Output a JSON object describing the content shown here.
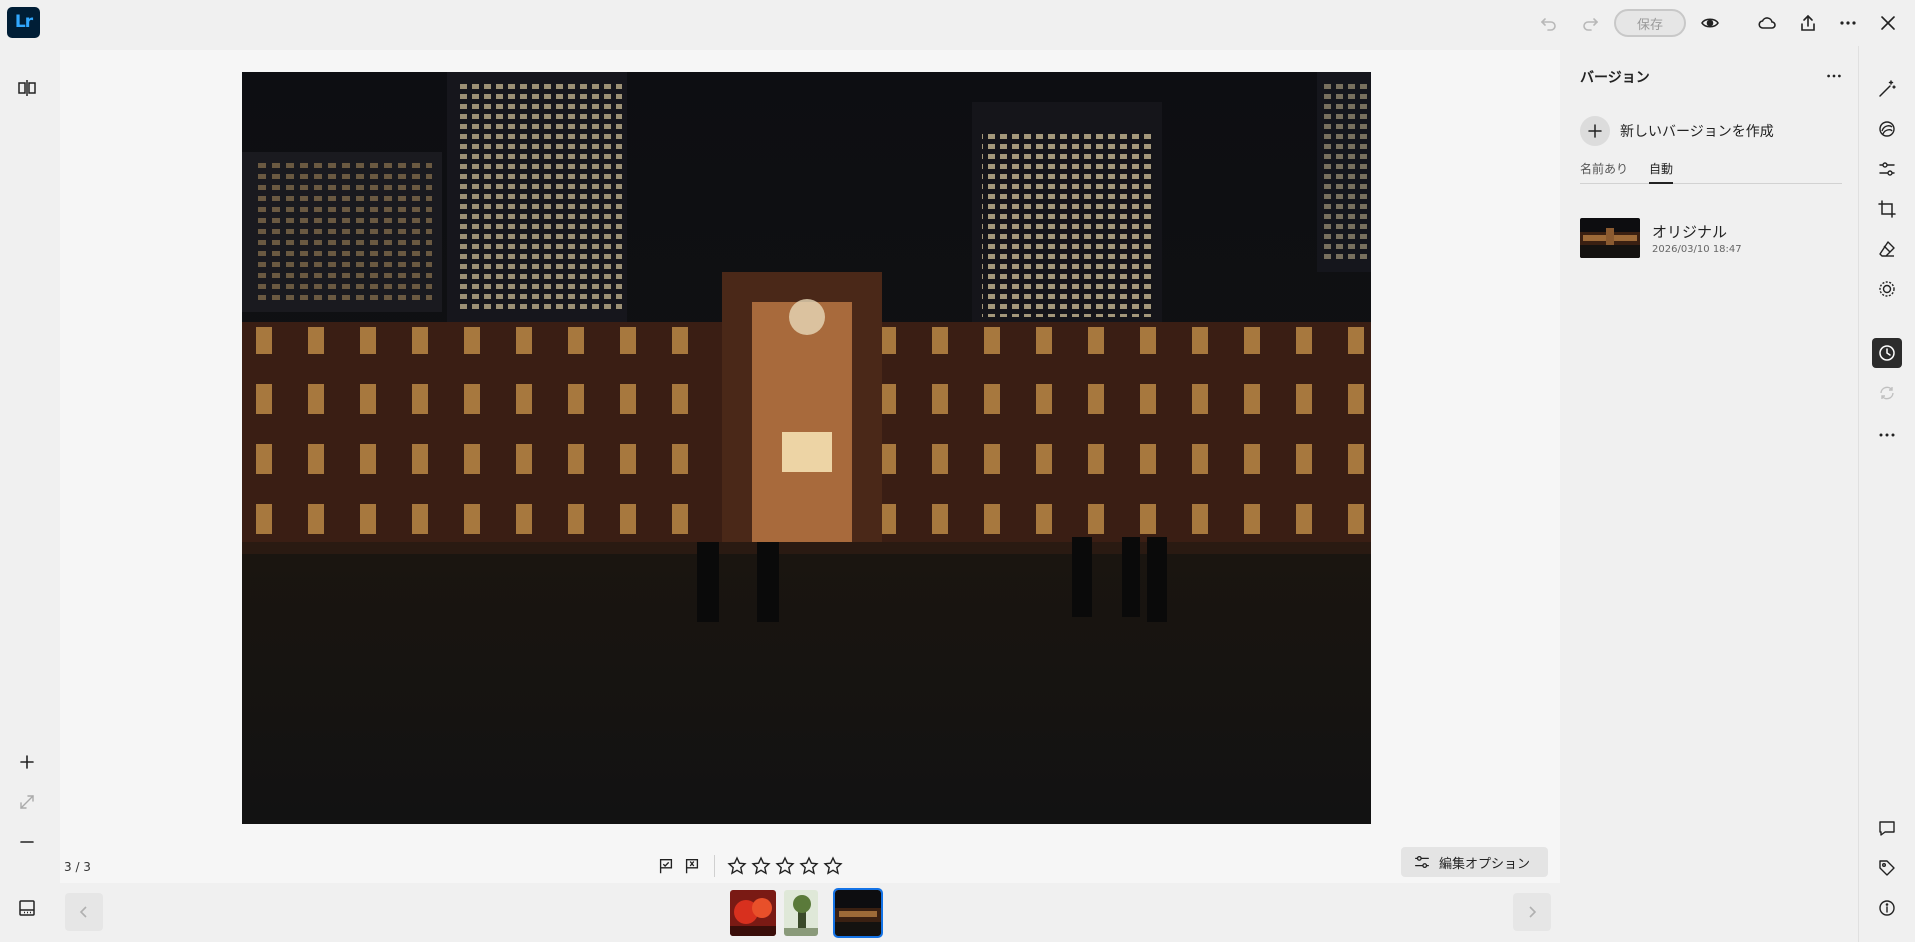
{
  "app": {
    "logo_text": "Lr",
    "brand_color": "#31a8ff"
  },
  "toolbar": {
    "save_label": "保存",
    "icons": [
      "undo-icon",
      "redo-icon",
      "eye-icon",
      "cloud-icon",
      "share-icon",
      "more-icon",
      "close-icon"
    ]
  },
  "left_tools": [
    "compare-view-icon",
    "zoom-in-icon",
    "fit-icon",
    "zoom-out-icon",
    "filmstrip-toggle-icon"
  ],
  "canvas": {
    "counter": "3 / 3"
  },
  "rating": {
    "stars": 0,
    "max": 5
  },
  "edit_options_label": "編集オプション",
  "filmstrip": {
    "thumbnails": [
      "red-flowers",
      "green-tree",
      "night-station"
    ],
    "selected_index": 2
  },
  "versions_panel": {
    "title": "バージョン",
    "new_version_label": "新しいバージョンを作成",
    "tabs": [
      {
        "label": "名前あり",
        "active": false
      },
      {
        "label": "自動",
        "active": true
      }
    ],
    "items": [
      {
        "name": "オリジナル",
        "date": "2026/03/10 18:47"
      }
    ]
  },
  "right_tools": [
    "auto-wand-icon",
    "presets-icon",
    "edit-sliders-icon",
    "crop-icon",
    "eraser-icon",
    "masking-icon",
    "versions-history-icon",
    "remix-icon",
    "more-icon",
    "comment-icon",
    "tag-icon",
    "info-icon"
  ],
  "accent_selected": "#1473e6"
}
